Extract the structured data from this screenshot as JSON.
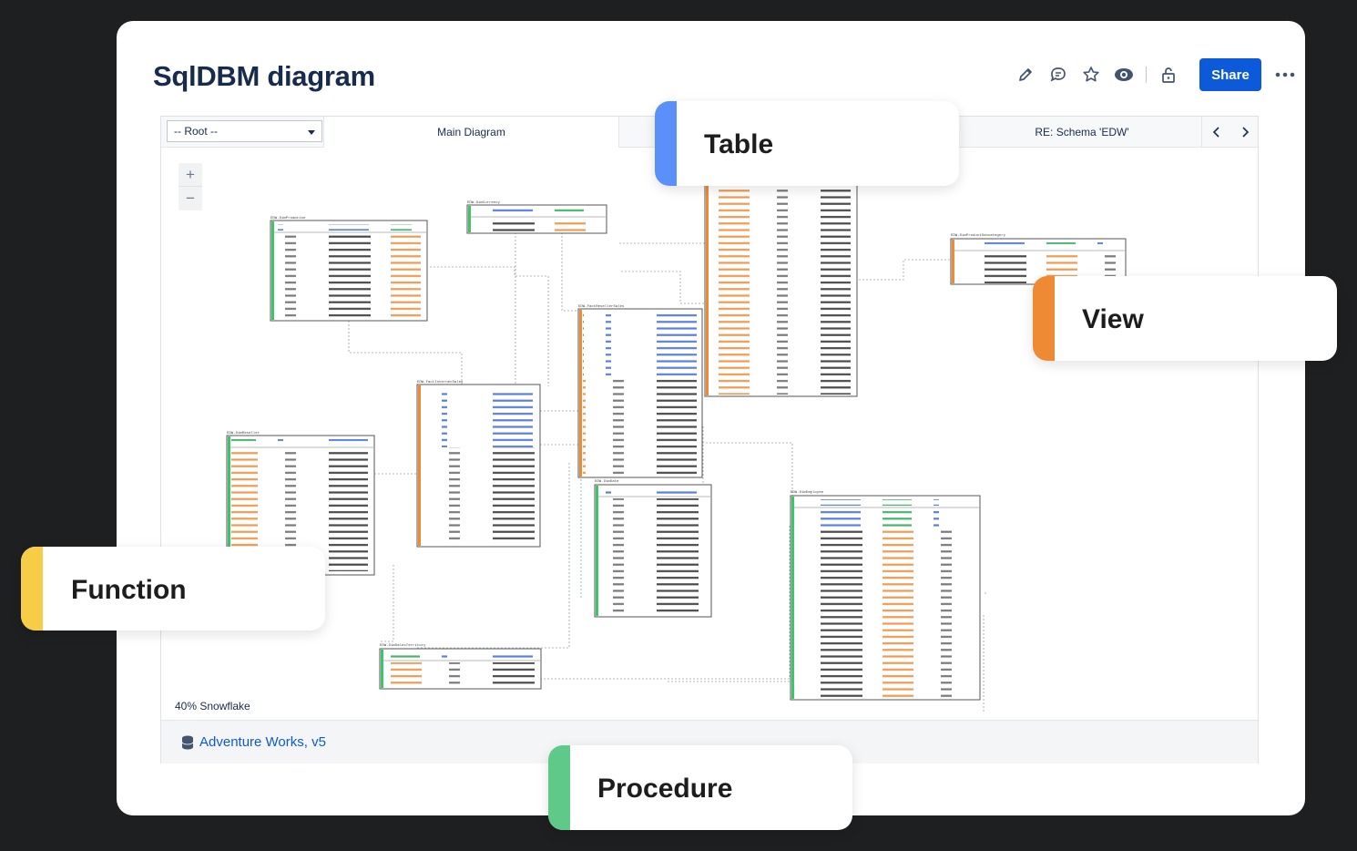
{
  "page": {
    "title": "SqlDBM diagram"
  },
  "toolbar": {
    "edit_icon": "pencil-icon",
    "comment_icon": "comment-icon",
    "star_icon": "star-icon",
    "watch_icon": "eye-icon",
    "restrict_icon": "unlock-icon",
    "share_label": "Share",
    "more_icon": "more-icon",
    "accent": "#0c5ad9"
  },
  "diagram": {
    "root_select": "-- Root --",
    "main_tab": "Main Diagram",
    "schema_tab": "RE: Schema 'EDW'",
    "zoom_in": "+",
    "zoom_out": "−",
    "zoom_label": "40% Snowflake"
  },
  "footer": {
    "link": "Adventure Works, v5"
  },
  "callouts": {
    "table": {
      "label": "Table",
      "color": "#5b8ff9"
    },
    "view": {
      "label": "View",
      "color": "#ef8a34"
    },
    "function": {
      "label": "Function",
      "color": "#f7cc46"
    },
    "procedure": {
      "label": "Procedure",
      "color": "#5fc98a"
    }
  }
}
